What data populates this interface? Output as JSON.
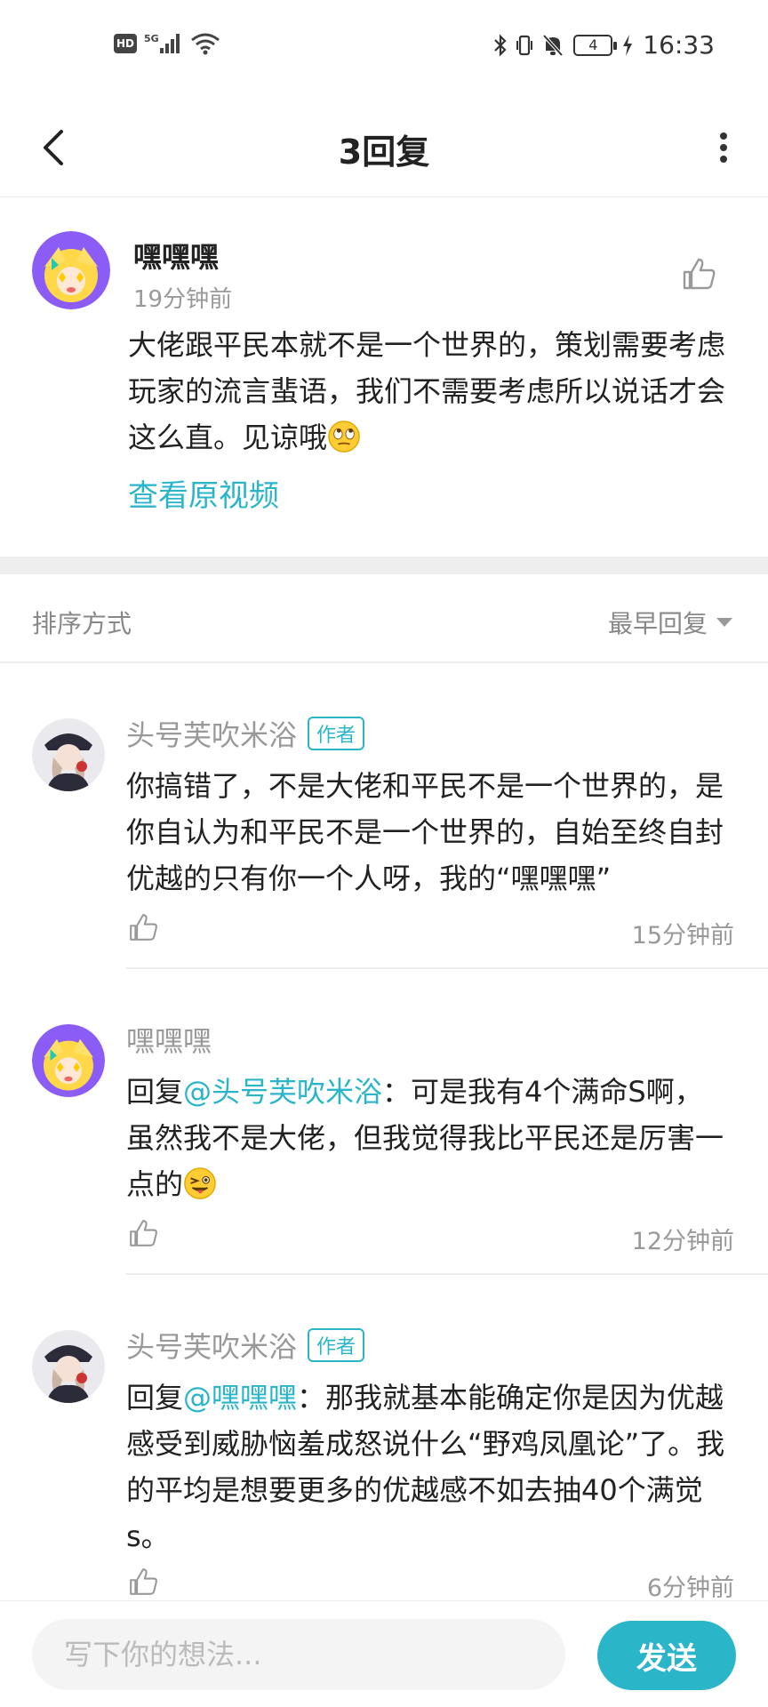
{
  "status_bar": {
    "hd_label": "HD",
    "network": "5G",
    "battery": "4",
    "time": "16:33"
  },
  "nav": {
    "title": "3回复"
  },
  "main_comment": {
    "username": "嘿嘿嘿",
    "time": "19分钟前",
    "text": "大佬跟平民本就不是一个世界的，策划需要考虑玩家的流言蜚语，我们不需要考虑所以说话才会这么直。见谅哦",
    "view_original": "查看原视频"
  },
  "sort": {
    "label": "排序方式",
    "selected": "最早回复"
  },
  "replies": [
    {
      "username": "头号芙吹米浴",
      "badge": "作者",
      "prefix": "",
      "mention": "",
      "text": "你搞错了，不是大佬和平民不是一个世界的，是你自认为和平民不是一个世界的，自始至终自封优越的只有你一个人呀，我的“嘿嘿嘿”",
      "time": "15分钟前"
    },
    {
      "username": "嘿嘿嘿",
      "badge": "",
      "prefix": "回复",
      "mention": "@头号芙吹米浴",
      "text": "：可是我有4个满命S啊，虽然我不是大佬，但我觉得我比平民还是厉害一点的",
      "time": "12分钟前"
    },
    {
      "username": "头号芙吹米浴",
      "badge": "作者",
      "prefix": "回复",
      "mention": "@嘿嘿嘿",
      "text": "：那我就基本能确定你是因为优越感受到威胁恼羞成怒说什么“野鸡凤凰论”了。我的平均是想要更多的优越感不如去抽40个满觉s。",
      "time": "6分钟前"
    }
  ],
  "input": {
    "placeholder": "写下你的想法...",
    "send_label": "发送"
  },
  "colors": {
    "accent": "#2bb5c8",
    "muted_text": "#999999",
    "separator": "#eeeeee"
  }
}
